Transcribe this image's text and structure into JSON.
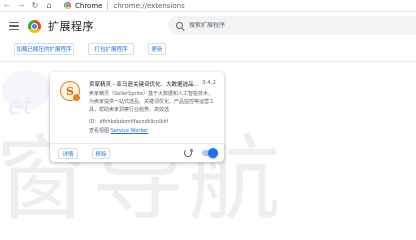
{
  "browser": {
    "tab_label": "Chrome",
    "url_host": "chrome://extensions"
  },
  "header": {
    "title": "扩展程序",
    "search_placeholder": "搜索扩展程序"
  },
  "toolbar": {
    "load_unpacked": "加载已解压的扩展程序",
    "pack_extension": "打包扩展程序",
    "update": "更新"
  },
  "extension": {
    "name": "卖家精灵 - 亚马逊关键词优化、大数据选品…",
    "version": "3.4.2",
    "description": "卖家精灵（SellerSprite）基于大数据和人工智能技术，为卖家提供一站式选品、关键词优化、产品监控等运营工具，帮助卖家洞察行业趋势、高效选",
    "id_label": "ID：",
    "id_value": "dfhhkebdomfifacodklicnlkkf",
    "view_label": "查看视图",
    "view_link": "Service Worker",
    "details_button": "详情",
    "remove_button": "移除",
    "enabled": true
  },
  "watermark": {
    "text": "窗导航",
    "side_text": "et"
  }
}
